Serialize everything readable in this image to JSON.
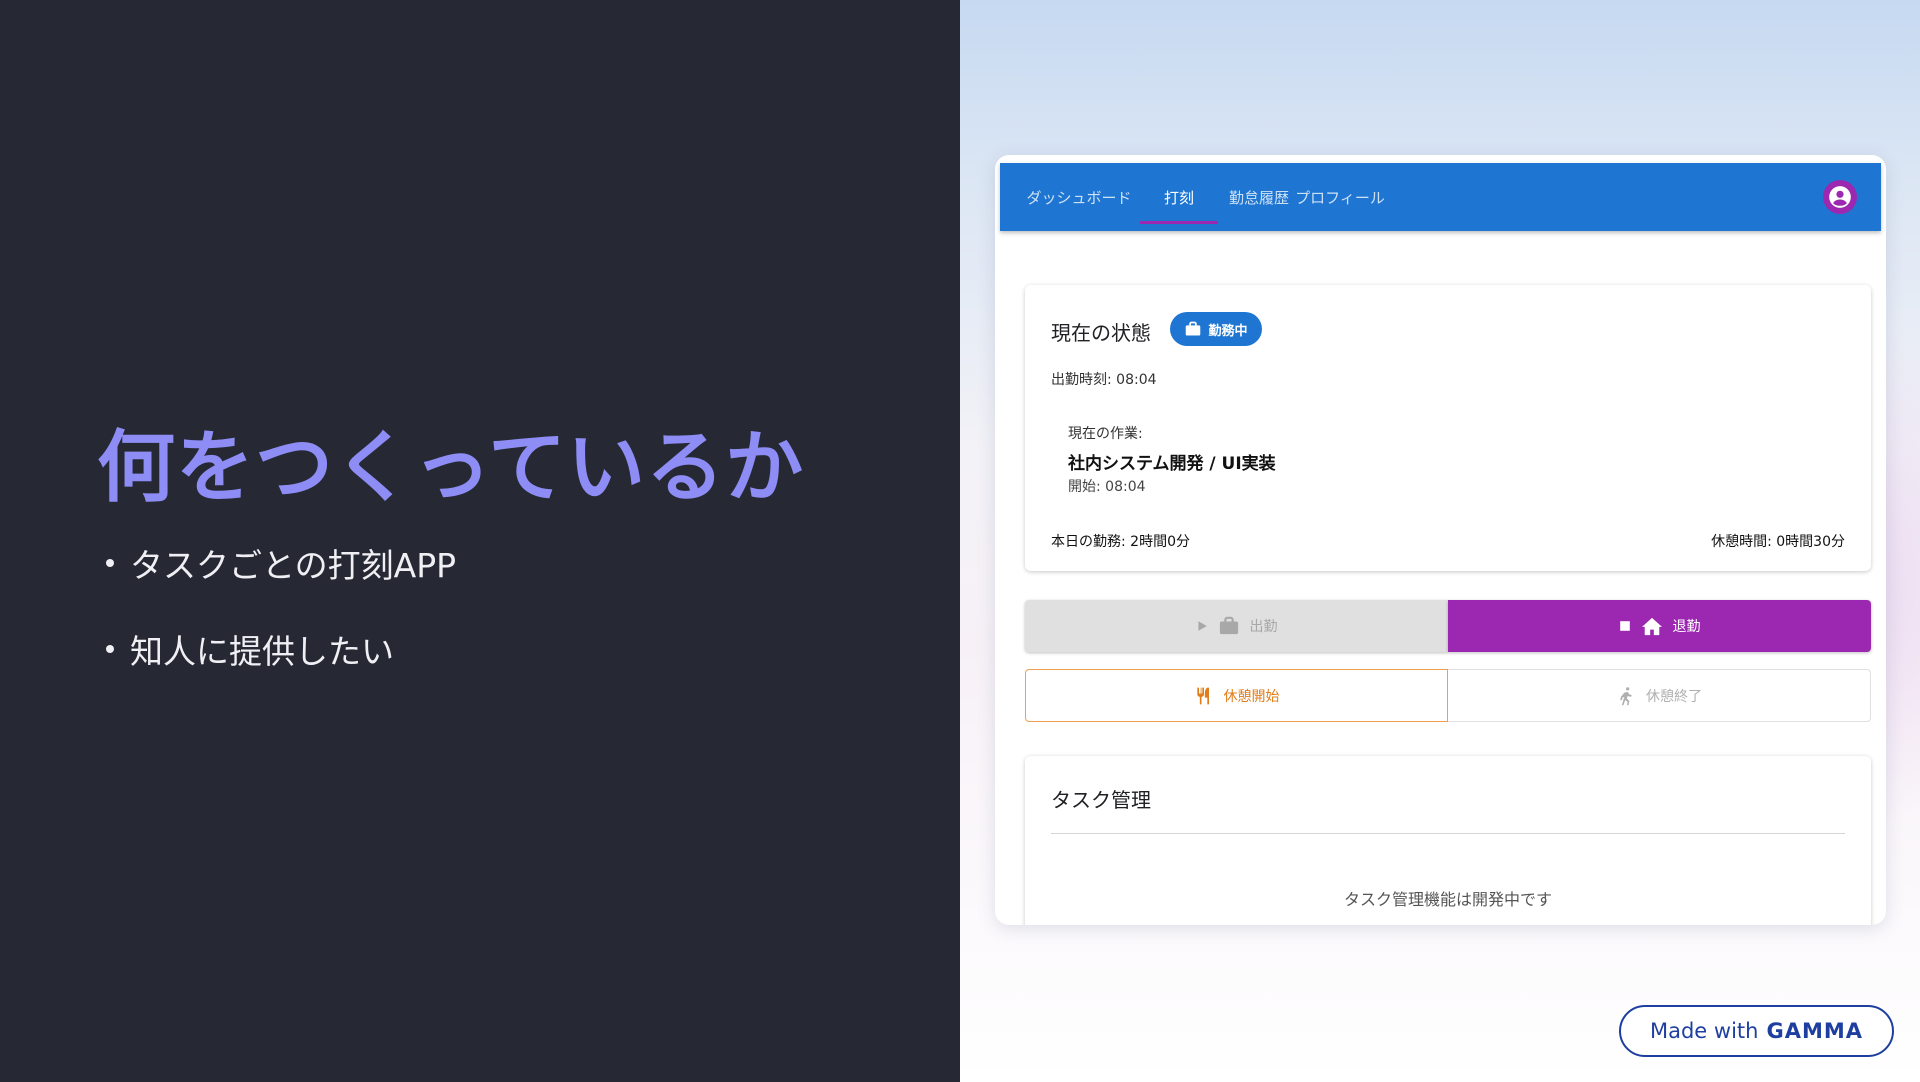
{
  "slide": {
    "title": "何をつくっているか",
    "bullets": [
      "タスクごとの打刻APP",
      "知人に提供したい"
    ]
  },
  "app": {
    "tabs": [
      {
        "label": "ダッシュボード",
        "active": false
      },
      {
        "label": "打刻",
        "active": true
      },
      {
        "label": "勤怠履歴",
        "active": false
      },
      {
        "label": "プロフィール",
        "active": false
      }
    ],
    "colors": {
      "primary": "#1f76d2",
      "accent": "#9c27b0",
      "warning": "#e07d1a"
    },
    "status": {
      "title": "現在の状態",
      "badge": "勤務中",
      "clock_in": "出勤時刻: 08:04",
      "current_task_label": "現在の作業:",
      "current_task_name": "社内システム開発 / UI実装",
      "current_task_start": "開始: 08:04",
      "today_work": "本日の勤務: 2時間0分",
      "break_time": "休憩時間: 0時間30分"
    },
    "buttons": {
      "clock_in": "出勤",
      "clock_out": "退勤",
      "break_start": "休憩開始",
      "break_end": "休憩終了"
    },
    "task": {
      "title": "タスク管理",
      "message": "タスク管理機能は開発中です"
    }
  },
  "gamma": {
    "made_with": "Made with",
    "brand": "GAMMA"
  }
}
